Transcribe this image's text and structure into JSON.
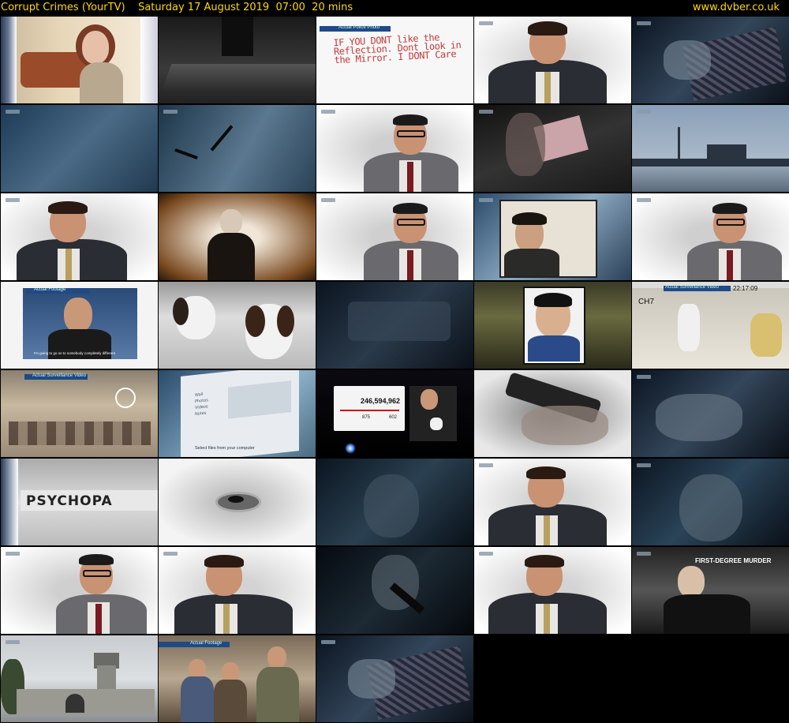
{
  "header": {
    "programme": "Corrupt Crimes (YourTV)",
    "datetime": "Saturday 17 August 2019  07:00  20 mins",
    "site": "www.dvber.co.uk",
    "text_color": "#ffd800"
  },
  "captions": {
    "actual_police_photo": "Actual Police Photo",
    "note_text": "IF YOU DONT like the Reflection. Dont look in the Mirror. I DONT Care",
    "actual_footage": "Actual Footage",
    "subtitle_line": "I'm going to go on to somebody completely different",
    "ch7": "CH7",
    "actual_surveillance": "Actual Surveillance Video",
    "timestamp": "22:17:09",
    "views_count": "246,594,962",
    "likes": "875",
    "dislikes": "602",
    "select_files": "Select files from your computer",
    "psychopath_text": "PSYCHOPA",
    "first_degree": "FIRST-DEGREE MURDER",
    "menu_items": [
      "Wall",
      "Photos",
      "Videos",
      "Notes"
    ]
  }
}
